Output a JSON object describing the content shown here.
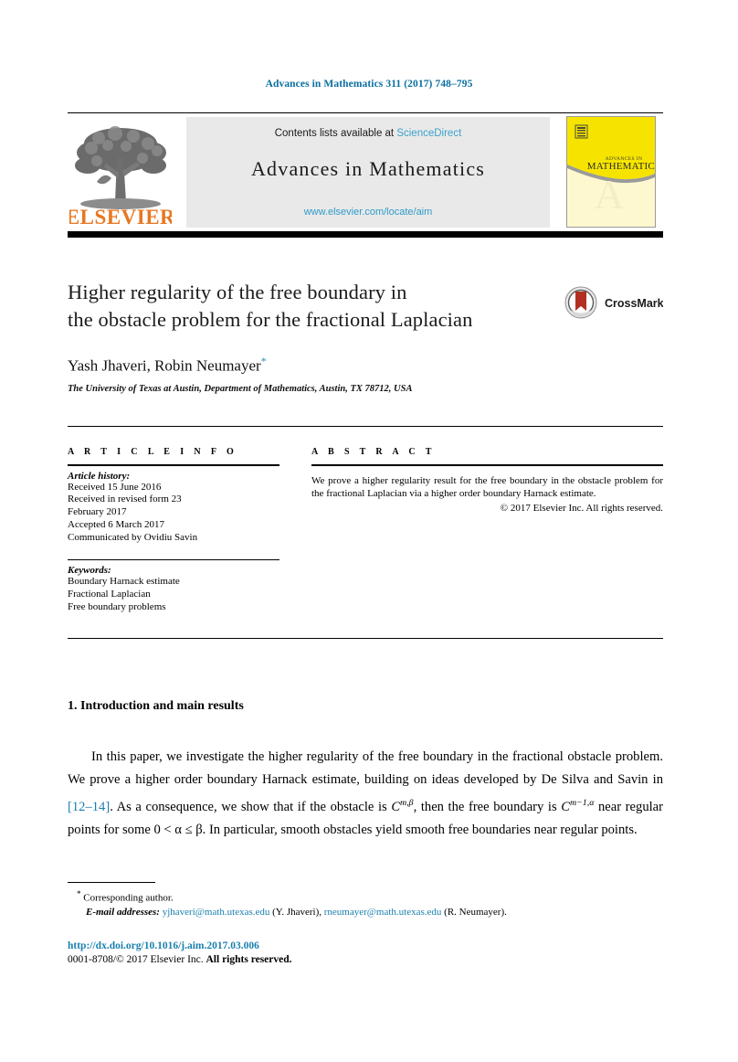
{
  "running_head": "Advances in Mathematics 311 (2017) 748–795",
  "masthead": {
    "contents_prefix": "Contents lists available at ",
    "sciencedirect": "ScienceDirect",
    "journal_title": "Advances in Mathematics",
    "journal_url": "www.elsevier.com/locate/aim",
    "publisher_wordmark": "ELSEVIER",
    "cover_title_small": "ADVANCES IN",
    "cover_title_main": "MATHEMATICS"
  },
  "article": {
    "title_line1": "Higher regularity of the free boundary in",
    "title_line2": "the obstacle problem for the fractional Laplacian",
    "crossmark_label": "CrossMark",
    "authors": "Yash Jhaveri, Robin Neumayer",
    "author_footnote_marker": "*",
    "affiliation_line1": "The University of Texas at Austin, Department of Mathematics, Austin, TX",
    "affiliation_line2": "78712, USA"
  },
  "info": {
    "heading": "A R T I C L E   I N F O",
    "history_label": "Article history:",
    "history": [
      "Received 15 June 2016",
      "Received in revised form 23",
      "February 2017",
      "Accepted 6 March 2017",
      "Communicated by Ovidiu Savin"
    ],
    "keywords_label": "Keywords:",
    "keywords": [
      "Boundary Harnack estimate",
      "Fractional Laplacian",
      "Free boundary problems"
    ]
  },
  "abstract": {
    "heading": "A B S T R A C T",
    "text": "We prove a higher regularity result for the free boundary in the obstacle problem for the fractional Laplacian via a higher order boundary Harnack estimate.",
    "rights": "© 2017 Elsevier Inc. All rights reserved."
  },
  "body": {
    "section_title": "1. Introduction and main results",
    "paragraph_part1": "In this paper, we investigate the higher regularity of the free boundary in the fractional obstacle problem. We prove a higher order boundary Harnack estimate, building on ideas developed by De Silva and Savin in ",
    "reference_link": "[12–14]",
    "paragraph_part2": ". As a consequence, we show that if the obstacle is ",
    "math1_base": "C",
    "math1_sup": "m,β",
    "paragraph_part3": ", then the free boundary is ",
    "math2_base": "C",
    "math2_sup": "m−1,α",
    "paragraph_part4": " near regular points for some 0 < α ≤ β. In particular, smooth obstacles yield smooth free boundaries near regular points."
  },
  "footnotes": {
    "corresponding_marker": "*",
    "corresponding_text": "Corresponding author.",
    "email_label": "E-mail addresses:",
    "email1": "yjhaveri@math.utexas.edu",
    "email1_owner": "(Y. Jhaveri),",
    "email2": "rneumayer@math.utexas.edu",
    "email2_owner": "(R. Neumayer)."
  },
  "footer": {
    "doi": "http://dx.doi.org/10.1016/j.aim.2017.03.006",
    "issn_copyright_prefix": "0001-8708/© 2017 Elsevier Inc. ",
    "issn_copyright_bold": "All rights reserved."
  },
  "colors": {
    "link_blue": "#1a7fae",
    "sciencedirect_blue": "#3ba3cc",
    "elsevier_orange": "#e87722",
    "cover_yellow": "#f6e400",
    "crossmark_red": "#b32f22"
  }
}
